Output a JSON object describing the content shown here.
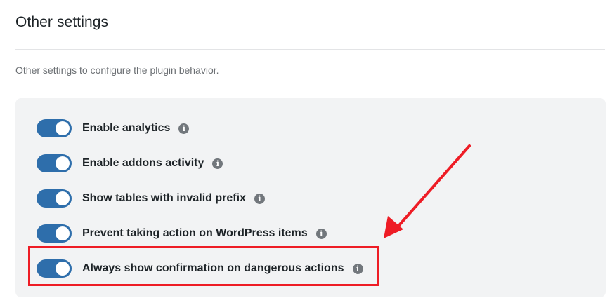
{
  "section": {
    "title": "Other settings",
    "description": "Other settings to configure the plugin behavior."
  },
  "settings": [
    {
      "label": "Enable analytics",
      "enabled": true,
      "icon": "info-icon"
    },
    {
      "label": "Enable addons activity",
      "enabled": true,
      "icon": "info-icon"
    },
    {
      "label": "Show tables with invalid prefix",
      "enabled": true,
      "icon": "info-icon"
    },
    {
      "label": "Prevent taking action on WordPress items",
      "enabled": true,
      "icon": "info-icon"
    },
    {
      "label": "Always show confirmation on dangerous actions",
      "enabled": true,
      "icon": "info-icon"
    }
  ],
  "info_glyph": "i",
  "colors": {
    "toggle_on": "#2e6eab",
    "panel_bg": "#f2f3f4",
    "annotation": "#ee1c25"
  }
}
